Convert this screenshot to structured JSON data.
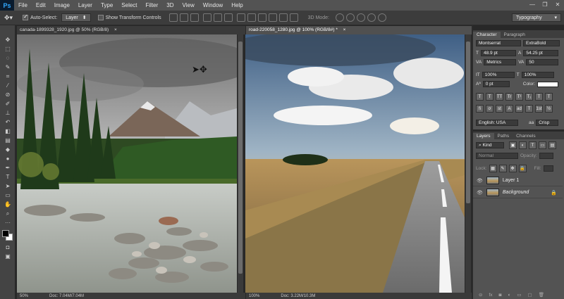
{
  "app": {
    "logo": "Ps"
  },
  "menu": [
    "File",
    "Edit",
    "Image",
    "Layer",
    "Type",
    "Select",
    "Filter",
    "3D",
    "View",
    "Window",
    "Help"
  ],
  "window_controls": {
    "minimize": "—",
    "restore": "❐",
    "close": "✕"
  },
  "options_bar": {
    "auto_select_label": "Auto-Select:",
    "auto_select_value": "Layer",
    "show_transform_label": "Show Transform Controls",
    "mode_3d_label": "3D Mode:",
    "workspace": "Typography"
  },
  "documents": [
    {
      "tab": "canada-1899328_1920.jpg @ 50% (RGB/8)",
      "zoom": "50%",
      "doc": "Doc: 7.04M/7.04M"
    },
    {
      "tab": "road-220058_1280.jpg @ 100% (RGB/8#) *",
      "zoom": "100%",
      "doc": "Doc: 3.22M/10.3M"
    }
  ],
  "character_panel": {
    "tabs": [
      "Character",
      "Paragraph"
    ],
    "font_family": "Montserrat",
    "font_style": "ExtraBold",
    "font_size": "48.9 pt",
    "leading": "54.25 pt",
    "kerning": "Metrics",
    "tracking": "50",
    "vertical_scale": "100%",
    "horizontal_scale": "100%",
    "baseline_shift": "0 pt",
    "color_label": "Color:",
    "color_value": "#ffffff",
    "style_buttons": [
      "T",
      "T",
      "TT",
      "Tr",
      "T¹",
      "T₁",
      "T",
      "T"
    ],
    "opentype_buttons": [
      "fi",
      "ơ",
      "st",
      "A",
      "ad",
      "T",
      "1st",
      "½"
    ],
    "language": "English: USA",
    "antialias_icon": "aa",
    "antialias": "Crisp"
  },
  "layers_panel": {
    "tabs": [
      "Layers",
      "Paths",
      "Channels"
    ],
    "filter": "Kind",
    "blend_mode": "Normal",
    "opacity_label": "Opacity:",
    "opacity_value": "",
    "lock_label": "Lock:",
    "fill_label": "Fill:",
    "fill_value": "",
    "layers": [
      {
        "name": "Layer 1",
        "visible": true,
        "locked": false
      },
      {
        "name": "Background",
        "visible": true,
        "locked": true
      }
    ]
  },
  "tools": [
    "move-tool",
    "marquee-tool",
    "lasso-tool",
    "quick-select-tool",
    "crop-tool",
    "eyedropper-tool",
    "healing-brush-tool",
    "brush-tool",
    "clone-stamp-tool",
    "history-brush-tool",
    "eraser-tool",
    "gradient-tool",
    "blur-tool",
    "dodge-tool",
    "pen-tool",
    "type-tool",
    "path-selection-tool",
    "shape-tool",
    "hand-tool",
    "zoom-tool"
  ],
  "colors": {
    "foreground": "#000000",
    "background": "#ffffff",
    "accent": "#31a8ff"
  }
}
